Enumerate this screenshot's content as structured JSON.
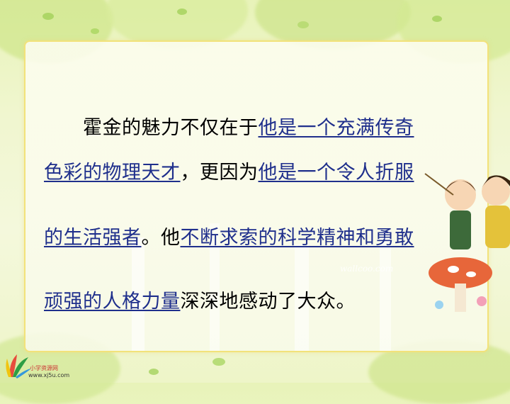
{
  "paragraphs": [
    {
      "segments": [
        {
          "text": "　　霍金的魅力不仅在于",
          "underline": false
        },
        {
          "text": "他是一个充满传奇",
          "underline": true
        }
      ]
    },
    {
      "segments": [
        {
          "text": "色彩的物理天才",
          "underline": true
        },
        {
          "text": "，更因为",
          "underline": false
        },
        {
          "text": "他是一个令人折服",
          "underline": true
        }
      ]
    },
    {
      "segments": [
        {
          "text": "的生活强者",
          "underline": true
        },
        {
          "text": "。他",
          "underline": false
        },
        {
          "text": "不断求索的科学精神和勇敢",
          "underline": true
        }
      ]
    },
    {
      "segments": [
        {
          "text": "顽强的人格力量",
          "underline": true
        },
        {
          "text": "深深地感动了大众。",
          "underline": false
        }
      ]
    }
  ],
  "logo": {
    "name": "小学资源网",
    "url": "www.xj5u.com"
  },
  "colors": {
    "underline_text": "#1f2f8c",
    "panel_border": "#f2e27a",
    "background": "#eef5c8"
  }
}
